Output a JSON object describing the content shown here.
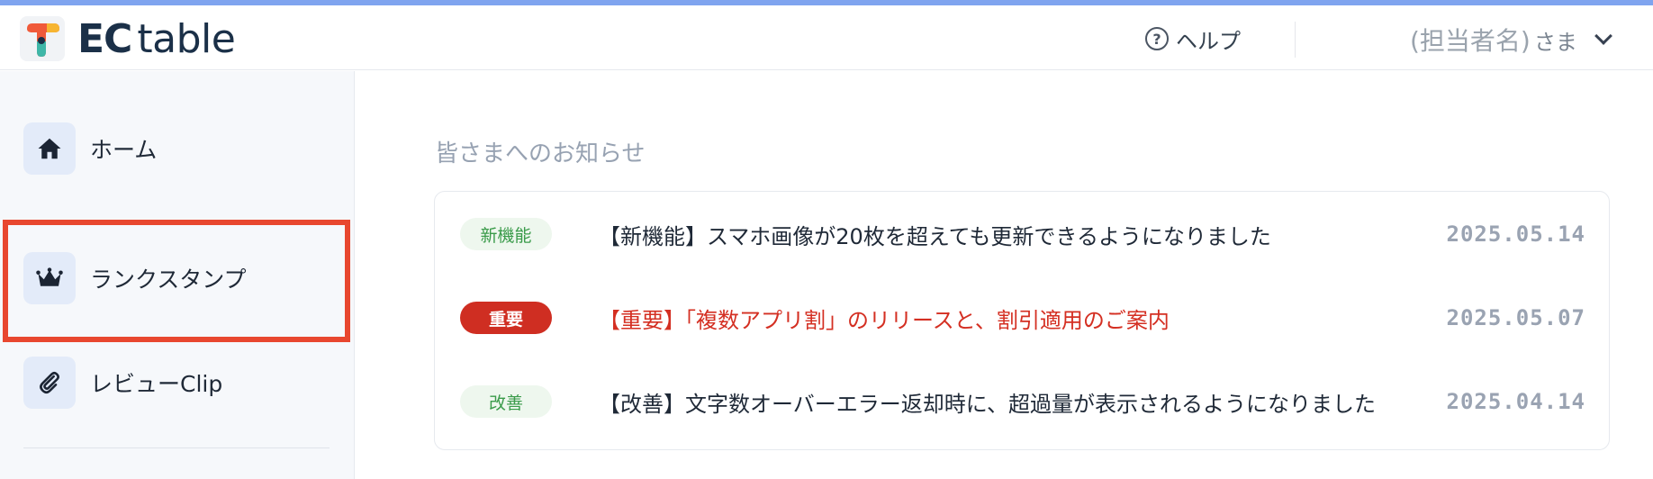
{
  "header": {
    "brand_ec": "EC",
    "brand_table": "table",
    "help_label": "ヘルプ",
    "help_icon": "help-circle-icon",
    "user_name": "(担当者名)",
    "user_suffix": "さま"
  },
  "sidebar": {
    "items": [
      {
        "label": "ホーム",
        "icon": "home-icon"
      },
      {
        "label": "ランクスタンプ",
        "icon": "crown-icon"
      },
      {
        "label": "レビューClip",
        "icon": "paperclip-icon"
      }
    ],
    "highlight_color": "#e8472f"
  },
  "notices": {
    "title": "皆さまへのお知らせ",
    "items": [
      {
        "badge": "新機能",
        "badge_style": "green",
        "text": "【新機能】スマホ画像が20枚を超えても更新できるようになりました",
        "date": "2025.05.14"
      },
      {
        "badge": "重要",
        "badge_style": "red",
        "text": "【重要】「複数アプリ割」のリリースと、割引適用のご案内",
        "date": "2025.05.07"
      },
      {
        "badge": "改善",
        "badge_style": "green",
        "text": "【改善】文字数オーバーエラー返却時に、超過量が表示されるようになりました",
        "date": "2025.04.14"
      }
    ]
  },
  "colors": {
    "accent_top": "#7fa4ef",
    "brand": "#1b3048",
    "important_red": "#cf2e22",
    "badge_green": "#3a9b4a"
  }
}
